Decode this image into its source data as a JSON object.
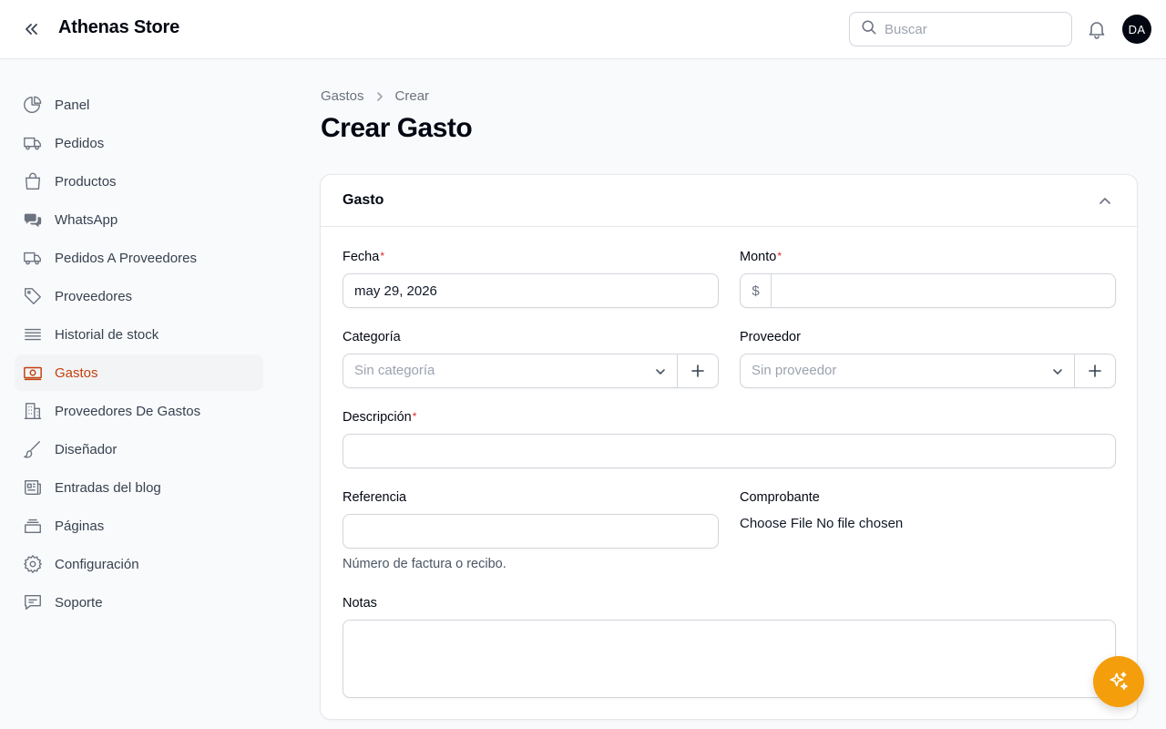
{
  "app": {
    "title": "Athenas Store"
  },
  "search": {
    "placeholder": "Buscar"
  },
  "user": {
    "initials": "DA"
  },
  "sidebar": {
    "items": [
      {
        "label": "Panel",
        "icon": "pie-chart-icon",
        "active": false
      },
      {
        "label": "Pedidos",
        "icon": "truck-icon",
        "active": false
      },
      {
        "label": "Productos",
        "icon": "shopping-bag-icon",
        "active": false
      },
      {
        "label": "WhatsApp",
        "icon": "chat-bubbles-icon",
        "active": false
      },
      {
        "label": "Pedidos A Proveedores",
        "icon": "truck-icon",
        "active": false
      },
      {
        "label": "Proveedores",
        "icon": "tag-icon",
        "active": false
      },
      {
        "label": "Historial de stock",
        "icon": "stack-icon",
        "active": false
      },
      {
        "label": "Gastos",
        "icon": "banknotes-icon",
        "active": true
      },
      {
        "label": "Proveedores De Gastos",
        "icon": "building-icon",
        "active": false
      },
      {
        "label": "Diseñador",
        "icon": "paintbrush-icon",
        "active": false
      },
      {
        "label": "Entradas del blog",
        "icon": "newspaper-icon",
        "active": false
      },
      {
        "label": "Páginas",
        "icon": "pages-icon",
        "active": false
      },
      {
        "label": "Configuración",
        "icon": "gear-icon",
        "active": false
      },
      {
        "label": "Soporte",
        "icon": "support-chat-icon",
        "active": false
      }
    ]
  },
  "breadcrumb": {
    "parent": "Gastos",
    "current": "Crear"
  },
  "page": {
    "title": "Crear Gasto"
  },
  "form": {
    "section_title": "Gasto",
    "fecha": {
      "label": "Fecha",
      "value": "may 29, 2026"
    },
    "monto": {
      "label": "Monto",
      "prefix": "$",
      "value": ""
    },
    "categoria": {
      "label": "Categoría",
      "placeholder": "Sin categoría"
    },
    "proveedor": {
      "label": "Proveedor",
      "placeholder": "Sin proveedor"
    },
    "descripcion": {
      "label": "Descripción",
      "value": ""
    },
    "referencia": {
      "label": "Referencia",
      "value": "",
      "hint": "Número de factura o recibo."
    },
    "comprobante": {
      "label": "Comprobante",
      "file_button": "Choose File",
      "file_status": "No file chosen"
    },
    "notas": {
      "label": "Notas",
      "value": ""
    },
    "required_mark": "*"
  },
  "colors": {
    "accent": "#c2410c",
    "fab": "#f59e0b",
    "required": "#dc2626"
  }
}
